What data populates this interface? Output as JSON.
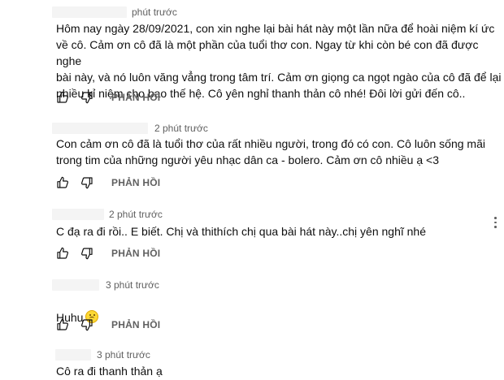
{
  "comments": [
    {
      "time": "phút trước",
      "text": "Hôm nay ngày 28/09/2021, con xin nghe lại bài hát này một lần nữa để hoài niệm kí ức\nvề cô. Cảm ơn cô đã là một phần của tuổi thơ con. Ngay từ khi còn bé con đã được nghe\nbài này, và nó luôn văng vẳng trong tâm trí. Cảm ơn giọng ca ngọt ngào của cô đã để lại\nnhiều kỉ niệm cho bao thế hệ. Cô yên nghỉ thanh thản cô nhé! Đôi lời gửi đến cô..",
      "reply_label": "PHẢN HỒI"
    },
    {
      "time": "2 phút trước",
      "text": "Con cảm ơn cô đã là tuổi thơ của rất nhiều người, trong đó có con. Cô luôn sống mãi\ntrong tim của những người yêu nhạc dân ca - bolero. Cảm ơn cô nhiều ạ <3",
      "reply_label": "PHẢN HỒI"
    },
    {
      "time": "2 phút trước",
      "text": "C đạ ra đi rồi.. E biết. Chị và thithích chị qua bài hát này..chị yên nghĩ nhé",
      "reply_label": "PHẢN HỒI"
    },
    {
      "time": "3 phút trước",
      "text": "Huhu",
      "emoji": "sad-face-emoji",
      "reply_label": "PHẢN HỒI"
    },
    {
      "time": "3 phút trước",
      "text": "Cô ra đi thanh thản ạ",
      "reply_label": ""
    }
  ],
  "icons": {
    "like": "thumbs-up-icon",
    "dislike": "thumbs-down-icon",
    "menu": "more-vertical-icon"
  },
  "colors": {
    "text": "#0f0f0f",
    "secondary": "#606060"
  }
}
